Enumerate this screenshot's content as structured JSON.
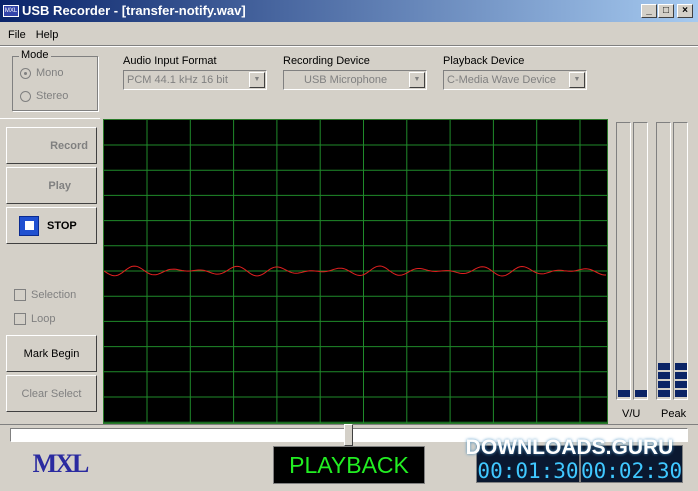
{
  "window": {
    "title": "USB Recorder  - [transfer-notify.wav]",
    "icon_text": "MXL",
    "min": "_",
    "max": "□",
    "close": "×"
  },
  "menu": [
    "File",
    "Help"
  ],
  "mode": {
    "label": "Mode",
    "options": [
      "Mono",
      "Stereo"
    ],
    "selected": "Mono"
  },
  "audio_format": {
    "label": "Audio Input Format",
    "value": "PCM 44.1 kHz 16 bit"
  },
  "recording_device": {
    "label": "Recording Device",
    "value": "USB Microphone"
  },
  "playback_device": {
    "label": "Playback Device",
    "value": "C-Media Wave Device"
  },
  "buttons": {
    "record": "Record",
    "play": "Play",
    "stop": "STOP",
    "mark_begin": "Mark Begin",
    "clear_select": "Clear Select"
  },
  "checkboxes": {
    "selection": "Selection",
    "loop": "Loop"
  },
  "meters": {
    "vu_label": "V/U",
    "peak_label": "Peak",
    "vu_level": [
      1,
      1
    ],
    "peak_level": [
      4,
      4
    ]
  },
  "position_slider": {
    "value_percent": 50
  },
  "status_display": "PLAYBACK",
  "times": {
    "position": "00:01:30",
    "length": "00:02:30"
  },
  "logo": "MXL",
  "watermark": "DOWNLOADS.GURU",
  "colors": {
    "scope_grid": "#1f8a2a",
    "waveform": "#e02020",
    "display_text": "#22ee22",
    "meter": "#0b2466"
  }
}
